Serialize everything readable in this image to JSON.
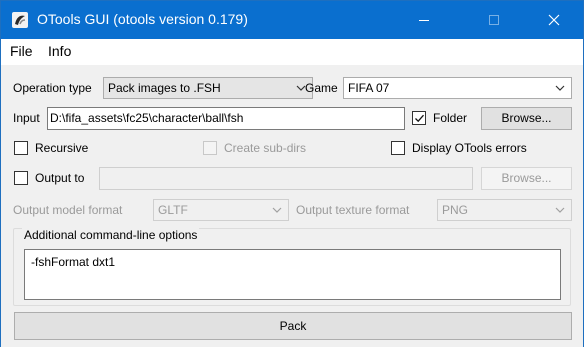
{
  "window": {
    "title": "OTools GUI (otools version 0.179)",
    "accent_color": "#0a6fcf",
    "icon": "app-logo-icon"
  },
  "menu": {
    "items": [
      "File",
      "Info"
    ]
  },
  "form": {
    "operation_type_label": "Operation type",
    "operation_type_value": "Pack images to .FSH",
    "game_label": "Game",
    "game_value": "FIFA 07",
    "input_label": "Input",
    "input_value": "D:\\fifa_assets\\fc25\\character\\ball\\fsh",
    "folder_label": "Folder",
    "folder_checked": true,
    "browse_label": "Browse...",
    "recursive_label": "Recursive",
    "recursive_checked": false,
    "create_subdirs_label": "Create sub-dirs",
    "create_subdirs_checked": false,
    "display_errors_label": "Display OTools errors",
    "display_errors_checked": false,
    "output_to_label": "Output to",
    "output_to_checked": false,
    "output_value": "",
    "output_browse_label": "Browse...",
    "output_model_format_label": "Output model format",
    "output_model_format_value": "GLTF",
    "output_texture_format_label": "Output texture format",
    "output_texture_format_value": "PNG"
  },
  "options": {
    "group_title": "Additional command-line options",
    "value": "-fshFormat dxt1"
  },
  "pack_button_label": "Pack"
}
